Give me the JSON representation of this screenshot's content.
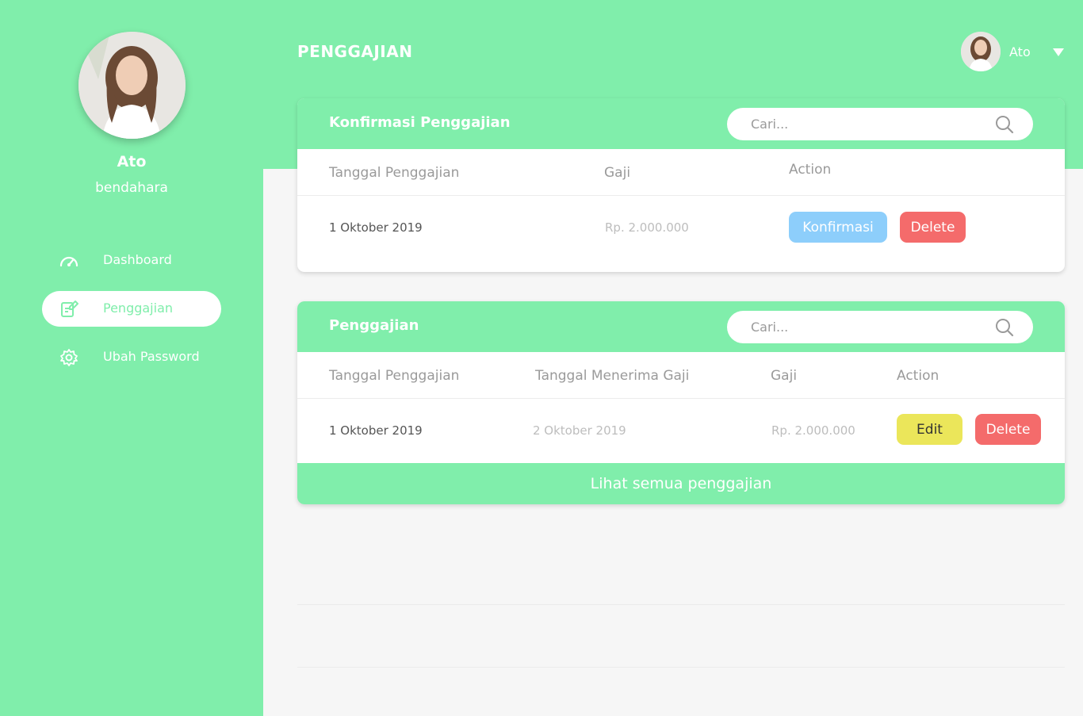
{
  "sidebar": {
    "profile": {
      "name": "Ato",
      "role": "bendahara"
    },
    "items": [
      {
        "label": "Dashboard",
        "icon": "speedometer-icon",
        "active": false
      },
      {
        "label": "Penggajian",
        "icon": "edit-document-icon",
        "active": true
      },
      {
        "label": "Ubah Password",
        "icon": "gear-icon",
        "active": false
      }
    ]
  },
  "header": {
    "title": "PENGGAJIAN",
    "user": {
      "name": "Ato"
    }
  },
  "confirm_card": {
    "title": "Konfirmasi Penggajian",
    "search_placeholder": "Cari...",
    "columns": [
      "Tanggal Penggajian",
      "Gaji",
      "Action"
    ],
    "rows": [
      {
        "tanggal": "1 Oktober 2019",
        "gaji": "Rp. 2.000.000",
        "confirm_label": "Konfirmasi",
        "delete_label": "Delete"
      }
    ]
  },
  "payroll_card": {
    "title": "Penggajian",
    "search_placeholder": "Cari...",
    "columns": [
      "Tanggal Penggajian",
      "Tanggal Menerima Gaji",
      "Gaji",
      "Action"
    ],
    "rows": [
      {
        "tanggal": "1 Oktober 2019",
        "tanggal_terima": "2 Oktober 2019",
        "gaji": "Rp. 2.000.000",
        "edit_label": "Edit",
        "delete_label": "Delete"
      }
    ],
    "view_all_label": "Lihat semua penggajian"
  },
  "colors": {
    "brand_green": "#80eeab",
    "confirm_blue": "#8dcefb",
    "delete_red": "#f46b6b",
    "edit_yellow": "#ebe65a"
  }
}
